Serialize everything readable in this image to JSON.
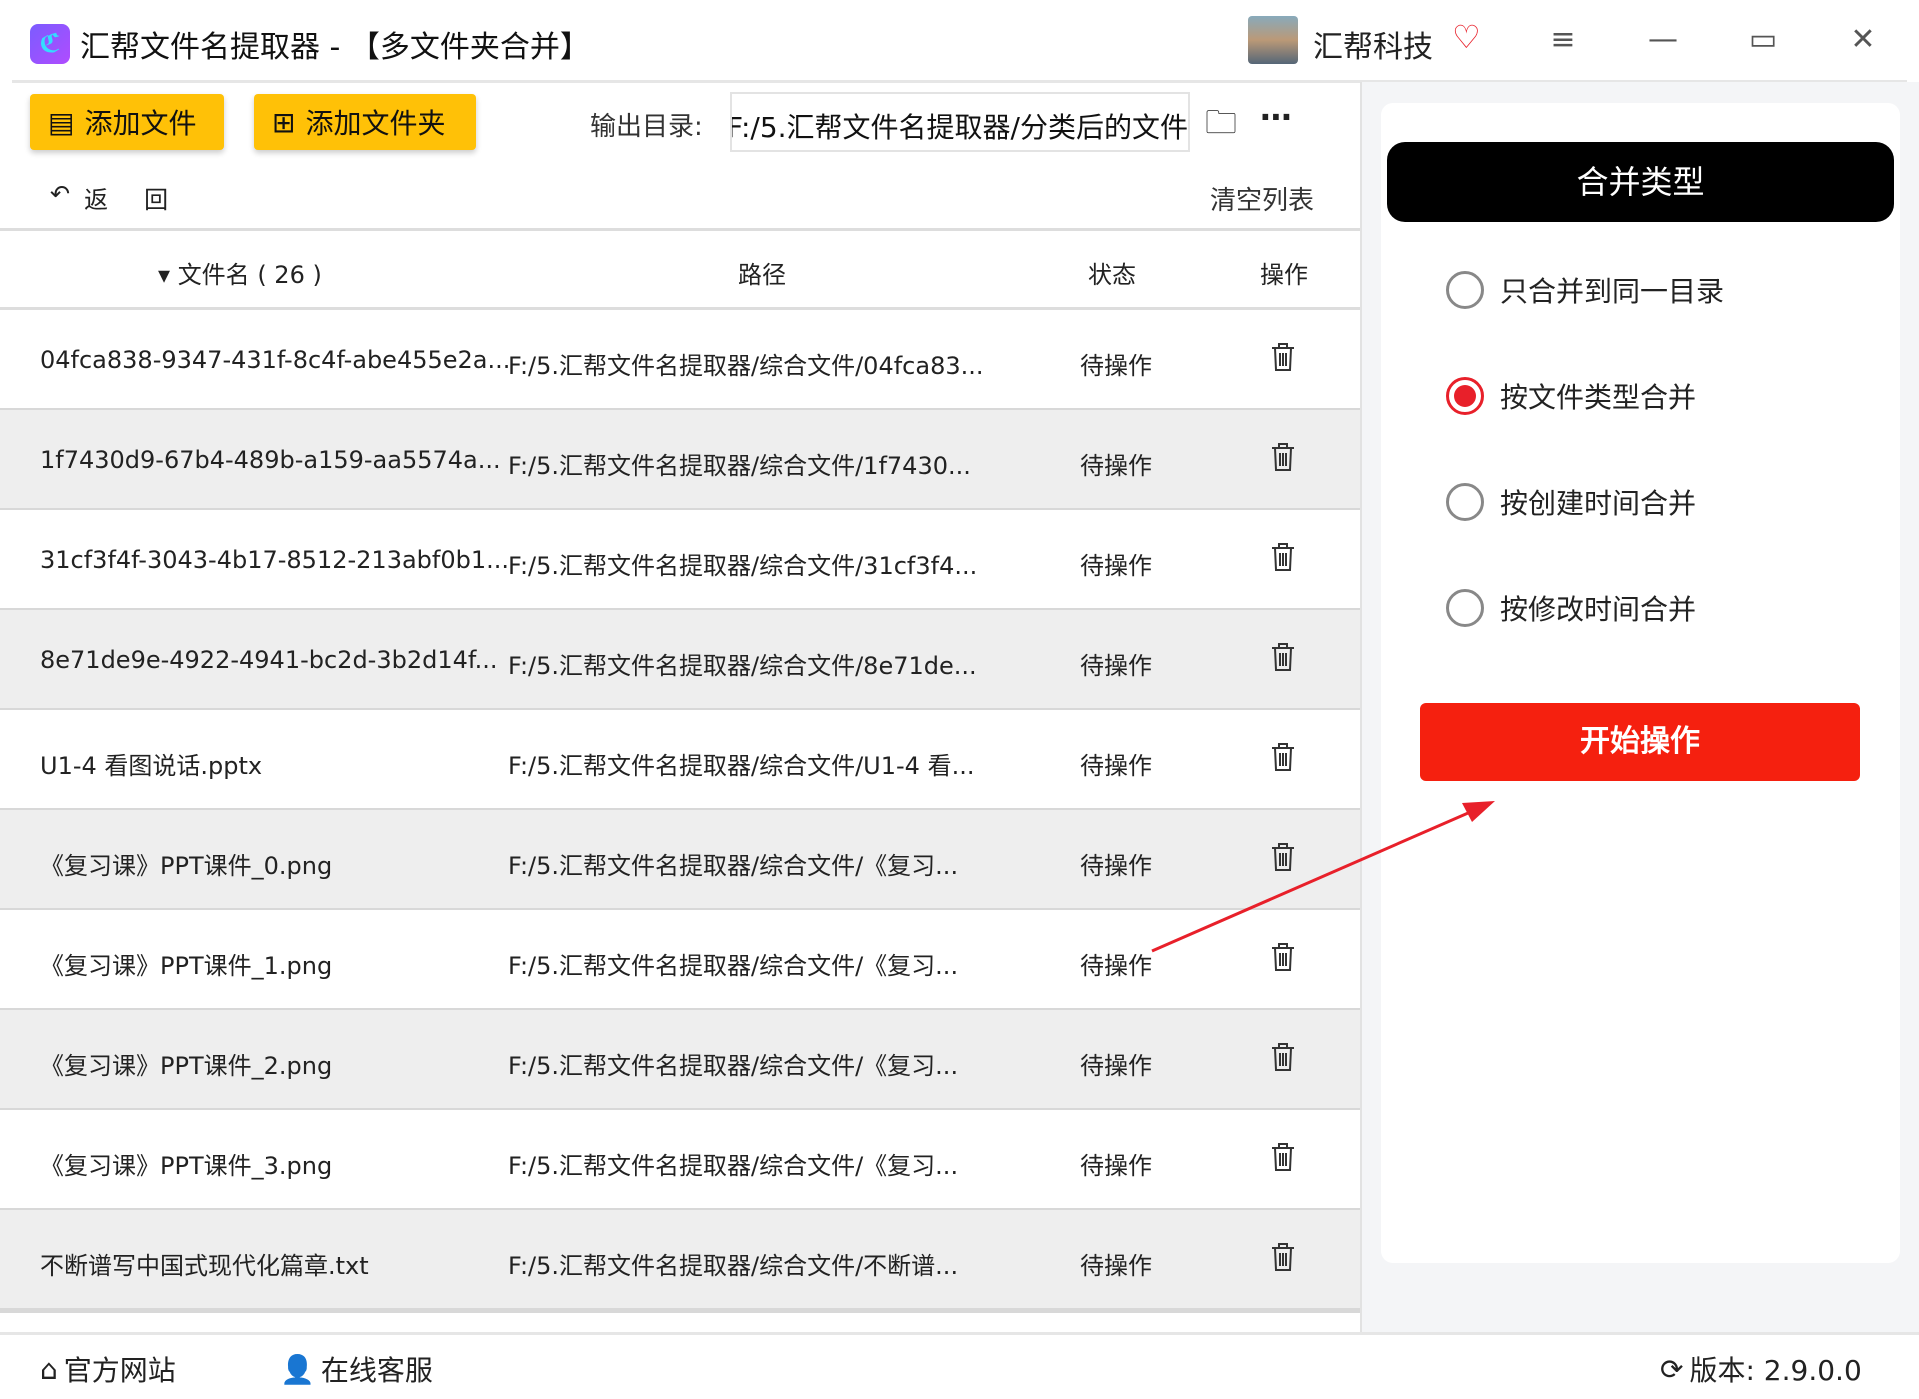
{
  "title": "汇帮文件名提取器 - 【多文件夹合并】",
  "brand": "汇帮科技",
  "toolbar": {
    "add_file": "添加文件",
    "add_folder": "添加文件夹",
    "output_label": "输出目录:",
    "output_value": "F:/5.汇帮文件名提取器/分类后的文件",
    "back": "返",
    "back2": "回",
    "clear": "清空列表"
  },
  "table": {
    "headers": {
      "name": "文件名 ( 26 )",
      "path": "路径",
      "status": "状态",
      "action": "操作"
    },
    "rows": [
      {
        "name": "04fca838-9347-431f-8c4f-abe455e2a...",
        "path": "F:/5.汇帮文件名提取器/综合文件/04fca83...",
        "status": "待操作"
      },
      {
        "name": "1f7430d9-67b4-489b-a159-aa5574a...",
        "path": "F:/5.汇帮文件名提取器/综合文件/1f7430...",
        "status": "待操作"
      },
      {
        "name": "31cf3f4f-3043-4b17-8512-213abf0b1...",
        "path": "F:/5.汇帮文件名提取器/综合文件/31cf3f4...",
        "status": "待操作"
      },
      {
        "name": "8e71de9e-4922-4941-bc2d-3b2d14f...",
        "path": "F:/5.汇帮文件名提取器/综合文件/8e71de...",
        "status": "待操作"
      },
      {
        "name": "U1-4 看图说话.pptx",
        "path": "F:/5.汇帮文件名提取器/综合文件/U1-4 看...",
        "status": "待操作"
      },
      {
        "name": "《复习课》PPT课件_0.png",
        "path": "F:/5.汇帮文件名提取器/综合文件/《复习...",
        "status": "待操作"
      },
      {
        "name": "《复习课》PPT课件_1.png",
        "path": "F:/5.汇帮文件名提取器/综合文件/《复习...",
        "status": "待操作"
      },
      {
        "name": "《复习课》PPT课件_2.png",
        "path": "F:/5.汇帮文件名提取器/综合文件/《复习...",
        "status": "待操作"
      },
      {
        "name": "《复习课》PPT课件_3.png",
        "path": "F:/5.汇帮文件名提取器/综合文件/《复习...",
        "status": "待操作"
      },
      {
        "name": "不断谱写中国式现代化篇章.txt",
        "path": "F:/5.汇帮文件名提取器/综合文件/不断谱...",
        "status": "待操作"
      }
    ]
  },
  "merge": {
    "header": "合并类型",
    "options": [
      "只合并到同一目录",
      "按文件类型合并",
      "按创建时间合并",
      "按修改时间合并"
    ],
    "selected": 1,
    "start": "开始操作"
  },
  "footer": {
    "website": "官方网站",
    "support": "在线客服",
    "version": "版本: 2.9.0.0"
  },
  "colors": {
    "accent_yellow": "#ffc107",
    "accent_red": "#f5200f"
  }
}
